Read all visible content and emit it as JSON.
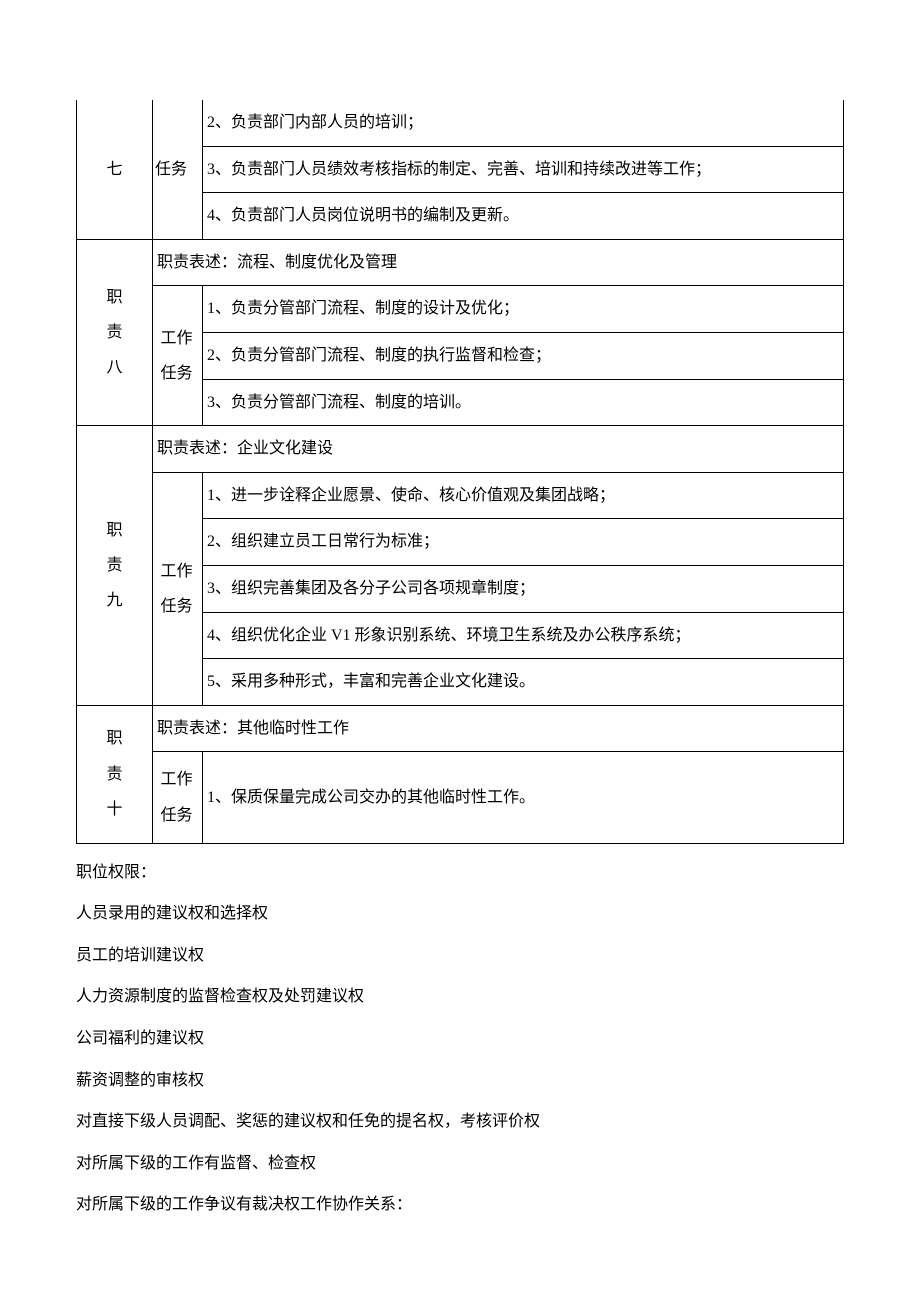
{
  "duty7": {
    "label_chars": [
      "七"
    ],
    "task_label": "任务",
    "items": [
      "2、负责部门内部人员的培训；",
      "3、负责部门人员绩效考核指标的制定、完善、培训和持续改进等工作；",
      "4、负责部门人员岗位说明书的编制及更新。"
    ]
  },
  "duty8": {
    "label_chars": [
      "职",
      "责",
      "八"
    ],
    "desc": "职责表述：流程、制度优化及管理",
    "task_label_chars": [
      "工作",
      "任务"
    ],
    "items": [
      "1、负责分管部门流程、制度的设计及优化；",
      "2、负责分管部门流程、制度的执行监督和检查；",
      "3、负责分管部门流程、制度的培训。"
    ]
  },
  "duty9": {
    "label_chars": [
      "职",
      "责",
      "九"
    ],
    "desc": "职责表述：企业文化建设",
    "task_label_chars": [
      "工作",
      "任务"
    ],
    "items": [
      "1、进一步诠释企业愿景、使命、核心价值观及集团战略；",
      "2、组织建立员工日常行为标准；",
      "3、组织完善集团及各分子公司各项规章制度；",
      "4、组织优化企业 V1 形象识别系统、环境卫生系统及办公秩序系统；",
      "5、采用多种形式，丰富和完善企业文化建设。"
    ]
  },
  "duty10": {
    "label_chars": [
      "职",
      "责",
      "十"
    ],
    "desc": "职责表述：其他临时性工作",
    "task_label_chars": [
      "工作",
      "任务"
    ],
    "items": [
      "1、保质保量完成公司交办的其他临时性工作。"
    ]
  },
  "authority": {
    "heading": "职位权限：",
    "lines": [
      "人员录用的建议权和选择权",
      "员工的培训建议权",
      "人力资源制度的监督检查权及处罚建议权",
      "公司福利的建议权",
      "薪资调整的审核权",
      "对直接下级人员调配、奖惩的建议权和任免的提名权，考核评价权",
      "对所属下级的工作有监督、检查权",
      "对所属下级的工作争议有裁决权工作协作关系："
    ]
  }
}
